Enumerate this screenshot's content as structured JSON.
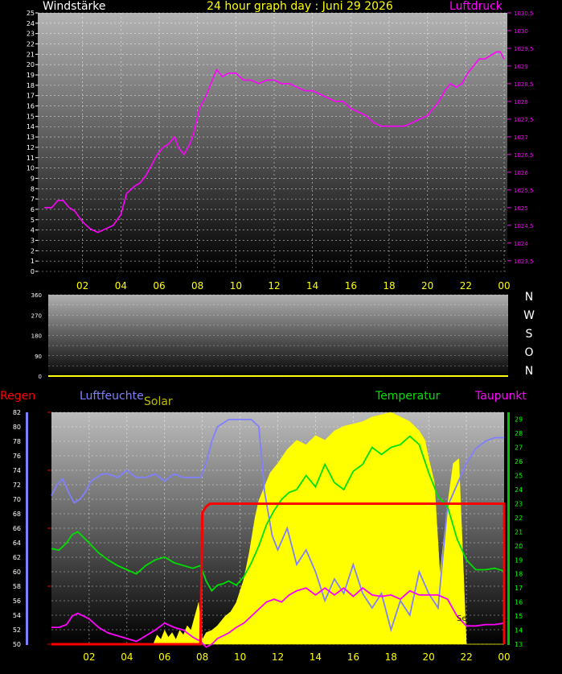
{
  "title": "24 hour graph day : Juni 29 2026",
  "colors": {
    "background": "#000000",
    "luftdruck": "#ff00ff",
    "windstaerke": "#ffffff",
    "regen": "#ff0000",
    "luftfeuchte": "#8080ff",
    "solar": "#ffff00",
    "temperatur": "#00e000",
    "taupunkt": "#ff00ff",
    "hour_tick": "#ffff00",
    "direction": "#ffffff"
  },
  "x_ticks": [
    "02",
    "04",
    "06",
    "08",
    "10",
    "12",
    "14",
    "16",
    "18",
    "20",
    "22",
    "00"
  ],
  "chart_data": [
    {
      "type": "line",
      "panel": "wind-pressure",
      "left_title": "Windstärke",
      "right_title": "Luftdruck",
      "left_axis": {
        "min": 0,
        "max": 25,
        "step": 1,
        "ticks": [
          "0",
          "1",
          "2",
          "3",
          "4",
          "5",
          "6",
          "7",
          "8",
          "9",
          "10",
          "11",
          "12",
          "13",
          "14",
          "15",
          "16",
          "17",
          "18",
          "19",
          "20",
          "21",
          "22",
          "23",
          "24",
          "25"
        ]
      },
      "right_axis": {
        "min": 1023.2,
        "max": 1030.5,
        "ticks": [
          "1023,5",
          "1024",
          "1024,5",
          "1025",
          "1025,5",
          "1026",
          "1026,5",
          "1027",
          "1027,5",
          "1028",
          "1028,5",
          "1029",
          "1029,5",
          "1030",
          "1030,5"
        ]
      },
      "x_range_hours": [
        0,
        24
      ],
      "grid": true,
      "series": [
        {
          "name": "Luftdruck",
          "axis": "right",
          "x": [
            0,
            0.4,
            0.7,
            1.0,
            1.3,
            1.6,
            2.0,
            2.4,
            2.8,
            3.2,
            3.6,
            4.0,
            4.3,
            4.7,
            5.0,
            5.3,
            5.6,
            5.9,
            6.2,
            6.5,
            6.8,
            7.0,
            7.3,
            7.6,
            7.8,
            8.1,
            8.4,
            8.7,
            9.0,
            9.3,
            9.6,
            10.0,
            10.4,
            10.8,
            11.2,
            11.6,
            12.0,
            12.4,
            12.8,
            13.2,
            13.6,
            14.0,
            14.4,
            14.8,
            15.2,
            15.6,
            16.0,
            16.4,
            16.8,
            17.2,
            17.6,
            18.0,
            18.4,
            18.8,
            19.2,
            19.6,
            20.0,
            20.3,
            20.6,
            20.9,
            21.2,
            21.5,
            21.8,
            22.1,
            22.4,
            22.7,
            23.0,
            23.3,
            23.6,
            23.8,
            24.0
          ],
          "values": [
            1025.0,
            1025.0,
            1025.2,
            1025.2,
            1025.0,
            1024.9,
            1024.6,
            1024.4,
            1024.3,
            1024.4,
            1024.5,
            1024.8,
            1025.4,
            1025.6,
            1025.7,
            1025.9,
            1026.2,
            1026.5,
            1026.7,
            1026.8,
            1027.0,
            1026.7,
            1026.5,
            1026.8,
            1027.1,
            1027.8,
            1028.1,
            1028.5,
            1028.9,
            1028.7,
            1028.8,
            1028.8,
            1028.6,
            1028.6,
            1028.5,
            1028.6,
            1028.6,
            1028.5,
            1028.5,
            1028.4,
            1028.3,
            1028.3,
            1028.2,
            1028.1,
            1028.0,
            1028.0,
            1027.8,
            1027.7,
            1027.6,
            1027.4,
            1027.3,
            1027.3,
            1027.3,
            1027.3,
            1027.4,
            1027.5,
            1027.6,
            1027.8,
            1028.0,
            1028.3,
            1028.5,
            1028.4,
            1028.5,
            1028.8,
            1029.0,
            1029.2,
            1029.2,
            1029.3,
            1029.4,
            1029.4,
            1029.2
          ]
        }
      ]
    },
    {
      "type": "scatter",
      "panel": "wind-direction",
      "y_axis": {
        "min": 0,
        "max": 360,
        "ticks": [
          "0",
          "90",
          "180",
          "270",
          "360"
        ]
      },
      "direction_labels": [
        "N",
        "W",
        "S",
        "O",
        "N"
      ],
      "grid": true,
      "series": []
    },
    {
      "type": "line",
      "panel": "weather",
      "labels": {
        "regen": "Regen",
        "luftfeuchte": "Luftfeuchte",
        "solar": "Solar",
        "temperatur": "Temperatur",
        "taupunkt": "Taupunkt",
        "set": "Set"
      },
      "humidity_axis": {
        "min": 50,
        "max": 82,
        "ticks": [
          "50",
          "52",
          "54",
          "56",
          "58",
          "60",
          "62",
          "64",
          "66",
          "68",
          "70",
          "72",
          "74",
          "76",
          "78",
          "80",
          "82"
        ]
      },
      "temperature_axis": {
        "min": 13,
        "max": 29.5,
        "ticks": [
          "13",
          "14",
          "15",
          "16",
          "17",
          "18",
          "19",
          "20",
          "21",
          "22",
          "23",
          "24",
          "25",
          "26",
          "27",
          "28",
          "29"
        ]
      },
      "x_range_hours": [
        0,
        24
      ],
      "grid": true,
      "series": [
        {
          "name": "Luftfeuchte",
          "x": [
            0,
            0.3,
            0.6,
            0.9,
            1.2,
            1.5,
            1.8,
            2.1,
            2.4,
            2.7,
            3.0,
            3.5,
            4.0,
            4.5,
            5.0,
            5.5,
            6.0,
            6.5,
            7.0,
            7.5,
            7.9,
            8.2,
            8.5,
            8.8,
            9.1,
            9.4,
            9.8,
            10.2,
            10.6,
            11.0,
            11.3,
            11.7,
            12.0,
            12.5,
            13.0,
            13.5,
            14.0,
            14.5,
            15.0,
            15.5,
            16.0,
            16.5,
            17.0,
            17.5,
            18.0,
            18.5,
            19.0,
            19.5,
            20.0,
            20.5,
            21.0,
            21.5,
            22.0,
            22.5,
            23.0,
            23.5,
            24.0
          ],
          "values": [
            70.5,
            72,
            72.8,
            71,
            69.5,
            70,
            71,
            72.5,
            73,
            73.5,
            73.5,
            73,
            74,
            73,
            73,
            73.5,
            72.5,
            73.5,
            73,
            73,
            73,
            75,
            78,
            80,
            80.5,
            81,
            81,
            81,
            81,
            80,
            71,
            65,
            63,
            66,
            61,
            63,
            60,
            56,
            59,
            57,
            61,
            57,
            55,
            57,
            52,
            56,
            54,
            60,
            57,
            55,
            69,
            72,
            75,
            77,
            78,
            78.5,
            78.5
          ]
        },
        {
          "name": "Temperatur",
          "x": [
            0,
            0.4,
            0.8,
            1.1,
            1.4,
            1.7,
            2.0,
            2.5,
            3.0,
            3.5,
            4.0,
            4.5,
            5.0,
            5.5,
            6.0,
            6.5,
            7.0,
            7.5,
            7.9,
            8.2,
            8.5,
            8.8,
            9.1,
            9.4,
            9.8,
            10.2,
            10.6,
            11.0,
            11.4,
            11.8,
            12.2,
            12.6,
            13.0,
            13.5,
            14.0,
            14.5,
            15.0,
            15.5,
            16.0,
            16.5,
            17.0,
            17.5,
            18.0,
            18.5,
            19.0,
            19.5,
            20.0,
            20.5,
            21.0,
            21.5,
            22.0,
            22.5,
            23.0,
            23.5,
            24.0
          ],
          "values": [
            19.8,
            19.7,
            20.2,
            20.8,
            21.0,
            20.6,
            20.2,
            19.5,
            19.0,
            18.6,
            18.3,
            18.0,
            18.6,
            19.0,
            19.2,
            18.8,
            18.6,
            18.4,
            18.6,
            17.5,
            16.8,
            17.2,
            17.3,
            17.5,
            17.2,
            17.8,
            18.8,
            20.0,
            21.5,
            22.5,
            23.3,
            23.8,
            24.0,
            25.0,
            24.2,
            25.8,
            24.5,
            24.0,
            25.3,
            25.8,
            27.0,
            26.5,
            27.0,
            27.2,
            27.8,
            27.2,
            25.2,
            23.5,
            22.8,
            20.5,
            19.0,
            18.3,
            18.3,
            18.4,
            18.2
          ]
        },
        {
          "name": "Taupunkt",
          "x": [
            0,
            0.4,
            0.8,
            1.1,
            1.4,
            1.7,
            2.0,
            2.5,
            3.0,
            3.5,
            4.0,
            4.5,
            5.0,
            5.5,
            6.0,
            6.5,
            7.0,
            7.5,
            7.9,
            8.2,
            8.5,
            8.8,
            9.1,
            9.4,
            9.8,
            10.2,
            10.6,
            11.0,
            11.4,
            11.8,
            12.2,
            12.6,
            13.0,
            13.5,
            14.0,
            14.5,
            15.0,
            15.5,
            16.0,
            16.5,
            17.0,
            17.5,
            18.0,
            18.5,
            19.0,
            19.5,
            20.0,
            20.5,
            21.0,
            21.5,
            22.0,
            22.5,
            23.0,
            23.5,
            24.0
          ],
          "values": [
            14.2,
            14.2,
            14.4,
            15.0,
            15.2,
            15.0,
            14.8,
            14.2,
            13.8,
            13.6,
            13.4,
            13.2,
            13.6,
            14.0,
            14.5,
            14.2,
            14.0,
            13.5,
            13.2,
            12.8,
            13.0,
            13.4,
            13.6,
            13.8,
            14.2,
            14.5,
            15.0,
            15.5,
            16.0,
            16.2,
            16.0,
            16.5,
            16.8,
            17.0,
            16.5,
            17.0,
            16.5,
            17.0,
            16.4,
            17.0,
            16.5,
            16.4,
            16.5,
            16.2,
            16.8,
            16.5,
            16.5,
            16.5,
            16.2,
            15.0,
            14.3,
            14.3,
            14.4,
            14.4,
            14.5
          ]
        },
        {
          "name": "Solar",
          "x": [
            0,
            5.4,
            5.6,
            5.8,
            6.0,
            6.2,
            6.4,
            6.6,
            6.8,
            7.0,
            7.2,
            7.4,
            7.6,
            7.8,
            7.9,
            8.0,
            8.2,
            8.5,
            8.8,
            9.0,
            9.2,
            9.5,
            9.8,
            10.2,
            10.5,
            10.8,
            11.0,
            11.3,
            11.6,
            12.0,
            12.5,
            13.0,
            13.5,
            14.0,
            14.5,
            15.0,
            15.5,
            16.0,
            16.5,
            17.0,
            17.5,
            18.0,
            18.5,
            19.0,
            19.5,
            19.8,
            20.0,
            20.3,
            20.6,
            21.0,
            21.3,
            21.6,
            21.8,
            22.0,
            24.0
          ],
          "values": [
            0,
            0,
            4,
            2,
            6,
            3,
            5,
            2,
            6,
            4,
            8,
            6,
            12,
            18,
            10,
            2,
            5,
            6,
            8,
            10,
            12,
            14,
            18,
            28,
            40,
            55,
            62,
            68,
            74,
            78,
            84,
            88,
            86,
            90,
            88,
            92,
            94,
            95,
            96,
            98,
            99,
            100,
            98,
            96,
            92,
            88,
            80,
            70,
            30,
            60,
            78,
            80,
            40,
            0,
            0
          ]
        },
        {
          "name": "Regen",
          "x": [
            0,
            7.9,
            8.0,
            8.2,
            8.4,
            24.0
          ],
          "values": [
            0,
            0,
            22.5,
            23.5,
            24.0,
            24.0
          ]
        }
      ]
    }
  ]
}
